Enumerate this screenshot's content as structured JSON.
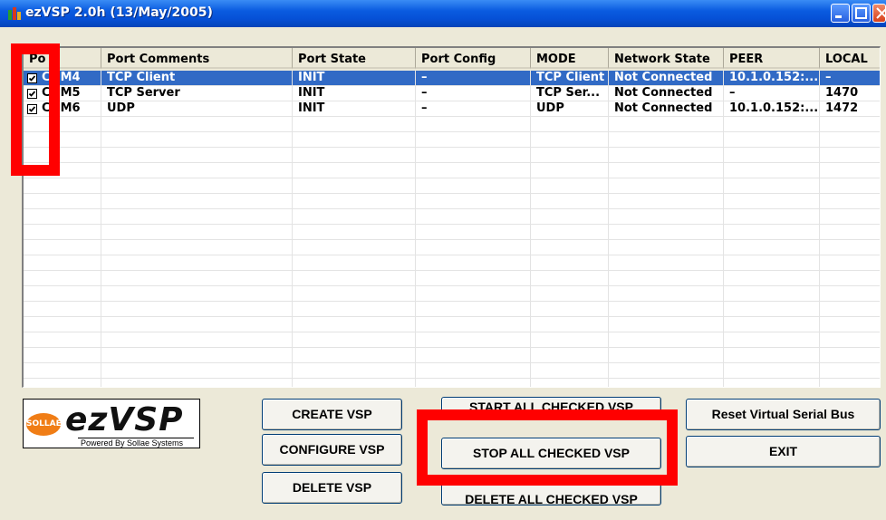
{
  "window": {
    "title": "ezVSP 2.0h (13/May/2005)"
  },
  "listview": {
    "columns": [
      "Po",
      "Port Comments",
      "Port State",
      "Port Config",
      "MODE",
      "Network State",
      "PEER",
      "LOCAL"
    ],
    "rows": [
      {
        "port": "COM4",
        "comment": "TCP Client",
        "state": "INIT",
        "config": "–",
        "mode": "TCP Client",
        "network": "Not Connected",
        "peer": "10.1.0.152:...",
        "local": "–",
        "checked": true,
        "selected": true
      },
      {
        "port": "COM5",
        "comment": "TCP Server",
        "state": "INIT",
        "config": "–",
        "mode": "TCP Ser...",
        "network": "Not Connected",
        "peer": "–",
        "local": "1470",
        "checked": true,
        "selected": false
      },
      {
        "port": "COM6",
        "comment": "UDP",
        "state": "INIT",
        "config": "–",
        "mode": "UDP",
        "network": "Not Connected",
        "peer": "10.1.0.152:...",
        "local": "1472",
        "checked": true,
        "selected": false
      }
    ]
  },
  "logo": {
    "badge": "SOLLAE",
    "title": "ezVSP",
    "subtitle": "Powered By Sollae Systems"
  },
  "buttons": {
    "create": "CREATE VSP",
    "configure": "CONFIGURE VSP",
    "delete": "DELETE VSP",
    "start_all": "START ALL CHECKED VSP",
    "stop_all": "STOP ALL CHECKED VSP",
    "delete_all": "DELETE ALL CHECKED VSP",
    "reset_bus": "Reset Virtual Serial Bus",
    "exit": "EXIT"
  },
  "colors": {
    "selection": "#316ac5",
    "highlight": "#ff0000",
    "window_bg": "#ece9d8"
  }
}
